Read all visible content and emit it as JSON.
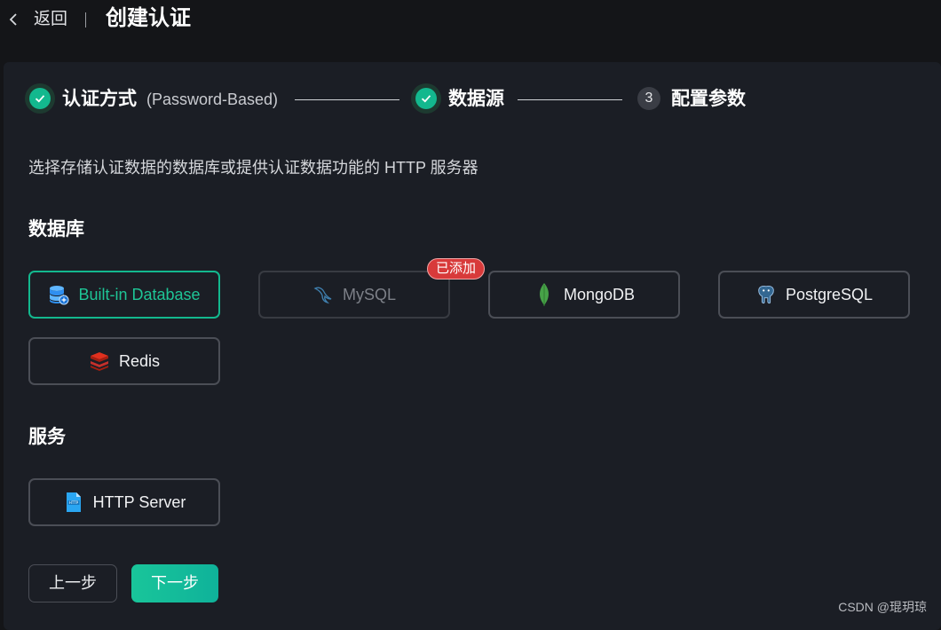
{
  "topbar": {
    "back_label": "返回",
    "title": "创建认证"
  },
  "steps": [
    {
      "title": "认证方式",
      "sub": "(Password-Based)",
      "state": "done"
    },
    {
      "title": "数据源",
      "state": "done"
    },
    {
      "number": "3",
      "title": "配置参数",
      "state": "current"
    }
  ],
  "description": "选择存储认证数据的数据库或提供认证数据功能的 HTTP 服务器",
  "sections": {
    "database": {
      "title": "数据库",
      "options": [
        {
          "label": "Built-in Database",
          "icon": "database-icon",
          "state": "selected"
        },
        {
          "label": "MySQL",
          "icon": "mysql-dolphin-icon",
          "state": "disabled",
          "badge": "已添加"
        },
        {
          "label": "MongoDB",
          "icon": "mongodb-leaf-icon",
          "state": "normal"
        },
        {
          "label": "PostgreSQL",
          "icon": "postgresql-elephant-icon",
          "state": "normal"
        },
        {
          "label": "Redis",
          "icon": "redis-cube-icon",
          "state": "normal"
        }
      ]
    },
    "service": {
      "title": "服务",
      "options": [
        {
          "label": "HTTP Server",
          "icon": "http-file-icon",
          "state": "normal"
        }
      ]
    }
  },
  "buttons": {
    "prev": "上一步",
    "next": "下一步"
  },
  "watermark": "CSDN @琨玥琼",
  "colors": {
    "accent": "#13b88e",
    "badge": "#d83a3a",
    "panel": "#1b1e25",
    "background": "#141518"
  }
}
